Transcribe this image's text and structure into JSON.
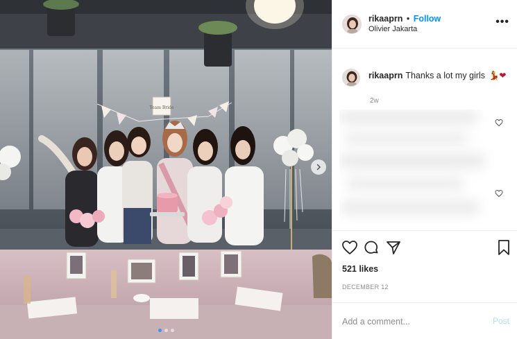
{
  "post": {
    "username": "rikaaprn",
    "separator": "•",
    "follow_label": "Follow",
    "location": "Olivier Jakarta",
    "more_label": "•••"
  },
  "caption": {
    "username": "rikaaprn",
    "text": "Thanks a lot my girls",
    "emoji": "💃❤",
    "time_ago": "2w"
  },
  "engagement": {
    "likes": "521 likes",
    "date": "DECEMBER 12"
  },
  "comment_form": {
    "placeholder": "Add a comment...",
    "post_label": "Post"
  },
  "carousel": {
    "total": 3,
    "active": 1
  },
  "photo": {
    "sign_text": "Team Bride"
  },
  "colors": {
    "link_blue": "#0095f6",
    "post_disabled": "#b2dffc",
    "dot_active": "#3897f0"
  }
}
